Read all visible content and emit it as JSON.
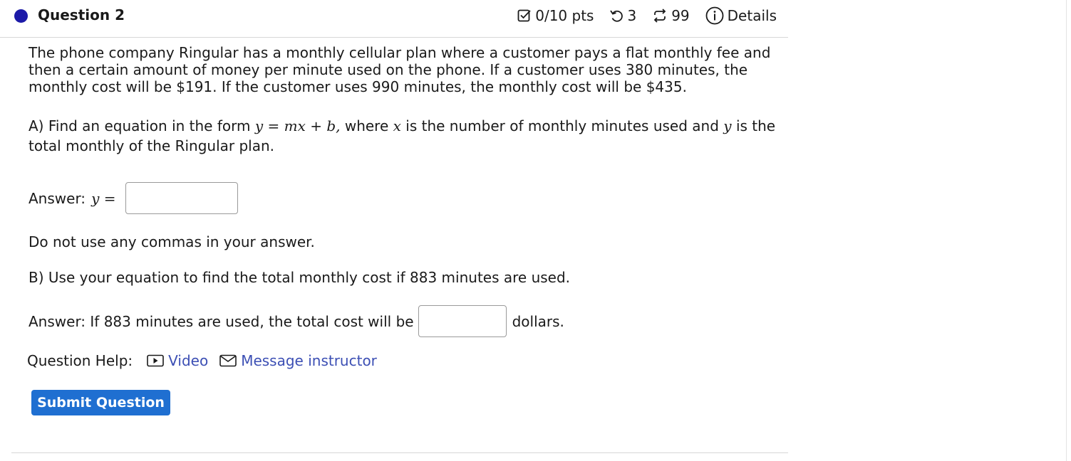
{
  "question": {
    "title": "Question 2",
    "points": "0/10 pts",
    "attempts": "3",
    "tries": "99",
    "details_label": "Details"
  },
  "body": {
    "intro": "The phone company Ringular has a monthly cellular plan where a customer pays a flat monthly fee and then a certain amount of money per minute used on the phone. If a customer uses 380 minutes, the monthly cost will be $191. If the customer uses 990 minutes, the monthly cost will be $435.",
    "part_a_prefix": "A) Find an equation in the form",
    "part_a_equation": "y = mx + b,",
    "part_a_where": "where",
    "part_a_var_x": "x",
    "part_a_mid": "is the number of monthly minutes used and",
    "part_a_var_y": "y",
    "part_a_suffix": "is the total monthly of the Ringular plan.",
    "answer_a_label": "Answer:",
    "answer_a_math": "y =",
    "answer_a_value": "",
    "note": "Do not use any commas in your answer.",
    "part_b": "B) Use your equation to find the total monthly cost if 883 minutes are used.",
    "answer_b_prefix": "Answer: If 883 minutes are used, the total cost will be",
    "answer_b_value": "",
    "answer_b_suffix": "dollars."
  },
  "help": {
    "label": "Question Help:",
    "video_label": "Video",
    "message_label": "Message instructor"
  },
  "submit_label": "Submit Question",
  "colors": {
    "status_dot": "#1c1aa8",
    "link": "#3c4fb4",
    "button": "#1f6fd1"
  }
}
